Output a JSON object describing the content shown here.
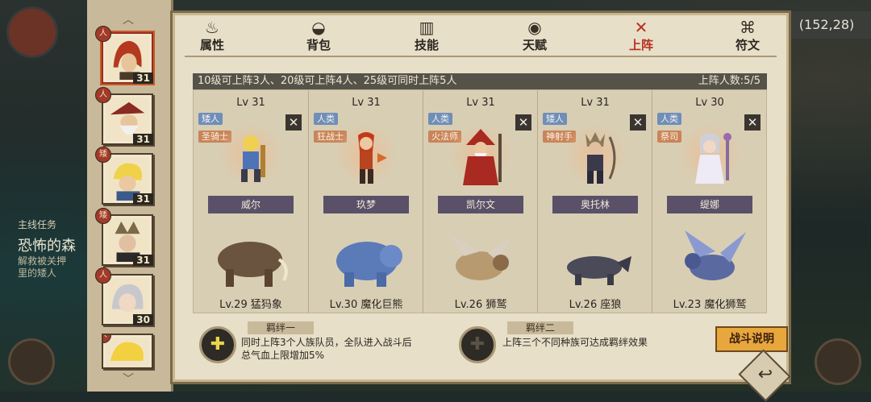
{
  "hud": {
    "coords": "(152,28)"
  },
  "quest": {
    "title": "主线任务",
    "name": "恐怖的森",
    "desc": "解救被关押\n里的矮人"
  },
  "hero_list": [
    {
      "level": "31",
      "selected": true
    },
    {
      "level": "31"
    },
    {
      "level": "31"
    },
    {
      "level": "31"
    },
    {
      "level": "30"
    },
    {
      "level": ""
    }
  ],
  "tabs": [
    {
      "label": "属性",
      "icon": "flame-icon"
    },
    {
      "label": "背包",
      "icon": "bag-icon"
    },
    {
      "label": "技能",
      "icon": "book-icon"
    },
    {
      "label": "天赋",
      "icon": "eye-icon"
    },
    {
      "label": "上阵",
      "icon": "crossed-swords-icon",
      "active": true
    },
    {
      "label": "符文",
      "icon": "rune-icon"
    }
  ],
  "info": {
    "rule": "10级可上阵3人、20级可上阵4人、25级可同时上阵5人",
    "count": "上阵人数:5/5"
  },
  "slots": [
    {
      "level": "Lv 31",
      "race": "矮人",
      "cls": "圣骑士",
      "name": "威尔",
      "pet": "Lv.29 猛犸象",
      "color": "#4e74b8"
    },
    {
      "level": "Lv 31",
      "race": "人类",
      "cls": "狂战士",
      "name": "玖梦",
      "pet": "Lv.30 魔化巨熊",
      "color": "#b84420"
    },
    {
      "level": "Lv 31",
      "race": "人类",
      "cls": "火法师",
      "name": "凯尔文",
      "pet": "Lv.26 狮鹫",
      "color": "#a82a20"
    },
    {
      "level": "Lv 31",
      "race": "矮人",
      "cls": "神射手",
      "name": "奥托林",
      "pet": "Lv.26 座狼",
      "color": "#3a3a4a"
    },
    {
      "level": "Lv 30",
      "race": "人类",
      "cls": "祭司",
      "name": "缇娜",
      "pet": "Lv.23 魔化狮鹫",
      "color": "#d8d4ee"
    }
  ],
  "bonds": [
    {
      "title": "羁绊一",
      "text_line1": "同时上阵3个人族队员，全队进入战斗后",
      "text_line2": "总气血上限增加5%"
    },
    {
      "title": "羁绊二",
      "text_line1": "上阵三个不同种族可达成羁绊效果",
      "text_line2": ""
    }
  ],
  "battle_button": "战斗说明",
  "colors": {
    "accent": "#b3311f",
    "panel": "#e8dfc9",
    "banner": "#5a5068",
    "race_tag": "#6f8eb8",
    "class_tag": "#c9855a"
  }
}
